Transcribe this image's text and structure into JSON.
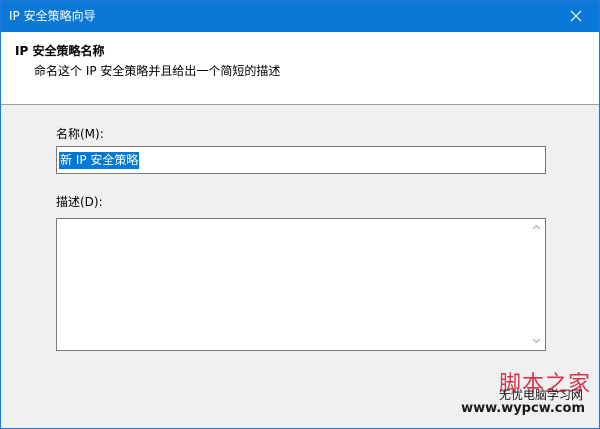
{
  "window": {
    "title": "IP 安全策略向导",
    "close_icon": "close-icon"
  },
  "header": {
    "title": "IP 安全策略名称",
    "subtitle": "命名这个 IP 安全策略并且给出一个简短的描述"
  },
  "form": {
    "name_label": "名称(M):",
    "name_value": "新 IP 安全策略",
    "description_label": "描述(D):",
    "description_value": ""
  },
  "watermark": {
    "line1": "脚本之家",
    "line2": "无忧电脑学习网",
    "line3": "www.wypcw.com"
  },
  "colors": {
    "titlebar": "#0b78d7",
    "selection": "#0078d7",
    "watermark_red": "#d9344a"
  }
}
